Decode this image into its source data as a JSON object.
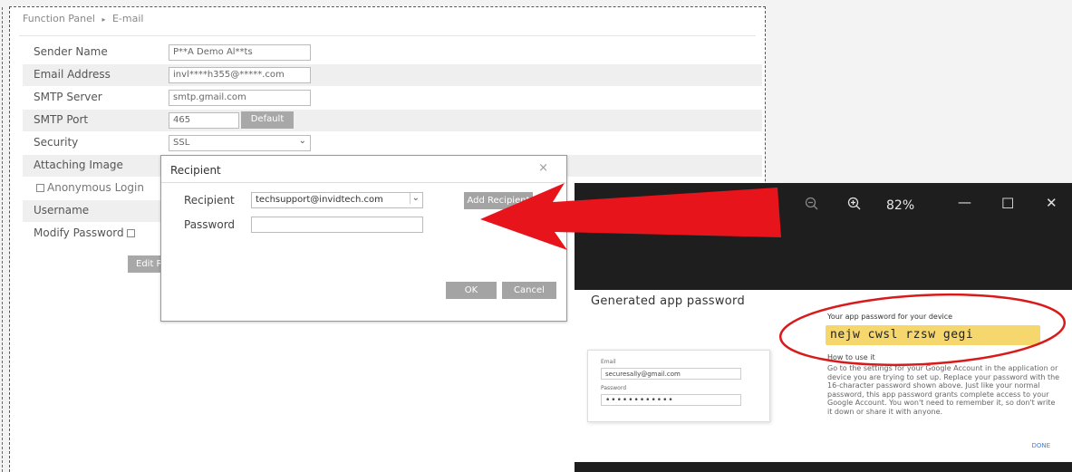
{
  "breadcrumb": {
    "root": "Function Panel",
    "separator": "▸",
    "current": "E-mail"
  },
  "form": {
    "sender_name": {
      "label": "Sender Name",
      "value": "P**A Demo Al**ts"
    },
    "email_address": {
      "label": "Email Address",
      "value": "invl****h355@*****.com"
    },
    "smtp_server": {
      "label": "SMTP Server",
      "value": "smtp.gmail.com"
    },
    "smtp_port": {
      "label": "SMTP Port",
      "value": "465",
      "default_button": "Default"
    },
    "security": {
      "label": "Security",
      "value": "SSL"
    },
    "attaching_image": {
      "label": "Attaching Image"
    },
    "anonymous_login": {
      "label": "Anonymous Login",
      "checked": false
    },
    "username": {
      "label": "Username"
    },
    "modify_password": {
      "label": "Modify Password",
      "checked": false
    },
    "edit_button": "Edit Re"
  },
  "dialog": {
    "title": "Recipient",
    "close_glyph": "×",
    "recipient_label": "Recipient",
    "recipient_value": "techsupport@invidtech.com",
    "add_button": "Add Recipient",
    "password_label": "Password",
    "password_value": "",
    "ok_button": "OK",
    "cancel_button": "Cancel"
  },
  "viewer": {
    "zoom_level": "82%",
    "zoom_out_icon": "zoom-out-icon",
    "zoom_in_icon": "zoom-in-icon",
    "minimize_glyph": "—",
    "maximize_glyph": "☐",
    "close_glyph": "✕",
    "screenshot": {
      "title": "Generated app password",
      "email_label": "Email",
      "email_value": "securesally@gmail.com",
      "password_label": "Password",
      "password_value": "••••••••••••",
      "pw_heading": "Your app password for your device",
      "app_password": "nejw cwsl rzsw gegi",
      "how_to": "How to use it",
      "instructions": "Go to the settings for your Google Account in the application or device you are trying to set up. Replace your password with the 16-character password shown above. Just like your normal password, this app password grants complete access to your Google Account. You won't need to remember it, so don't write it down or share it with anyone.",
      "done_button": "DONE"
    }
  },
  "colors": {
    "arrow": "#e8141c",
    "highlight": "#f5d76e",
    "panel_button": "#a8a8a8"
  }
}
